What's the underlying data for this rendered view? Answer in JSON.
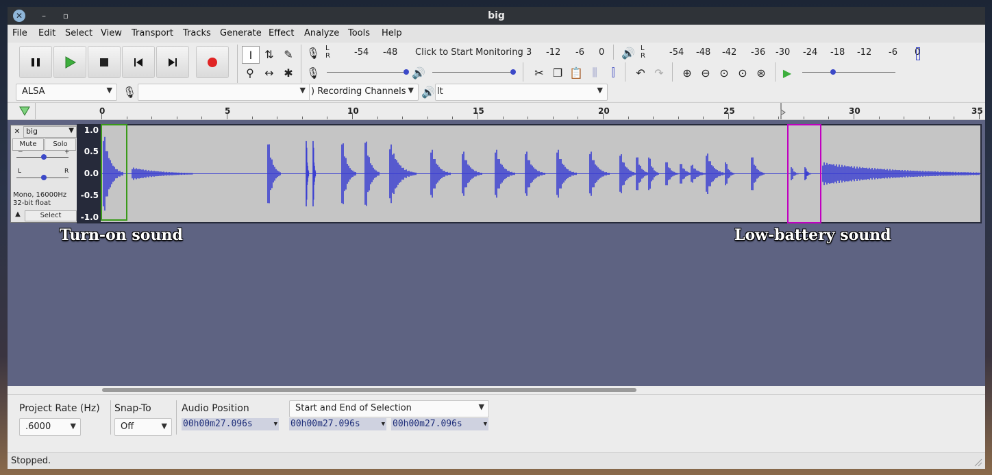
{
  "window": {
    "title": "big"
  },
  "menu": [
    "File",
    "Edit",
    "Select",
    "View",
    "Transport",
    "Tracks",
    "Generate",
    "Effect",
    "Analyze",
    "Tools",
    "Help"
  ],
  "meters": {
    "record_scale": [
      "-54",
      "-48",
      "Click to Start Monitoring",
      "3",
      "-12",
      "-6",
      "0"
    ],
    "play_scale": [
      "-54",
      "-48",
      "-42",
      "-36",
      "-30",
      "-24",
      "-18",
      "-12",
      "-6",
      "0"
    ],
    "record_lr": "L\nR",
    "play_lr": "L\nR"
  },
  "device": {
    "host": "ALSA",
    "recording_channels": ") Recording Channels",
    "playback_device": "lt"
  },
  "ruler": {
    "ticks": [
      "0",
      "5",
      "10",
      "15",
      "20",
      "25",
      "30",
      "35"
    ]
  },
  "track": {
    "name": "big",
    "mute": "Mute",
    "solo": "Solo",
    "info": "Mono, 16000Hz",
    "format": "32-bit float",
    "select": "Select",
    "y_labels": [
      "1.0",
      "0.5",
      "0.0",
      "-0.5",
      "-1.0"
    ]
  },
  "annotations": {
    "turn_on": "Turn-on sound",
    "low_battery": "Low-battery sound",
    "turn_on_color": "#3a9a1a",
    "low_battery_color": "#c000c0"
  },
  "selection_toolbar": {
    "project_rate_label": "Project Rate (Hz)",
    "project_rate_value": ".6000",
    "snap_to_label": "Snap-To",
    "snap_to_value": "Off",
    "audio_position_label": "Audio Position",
    "selection_mode": "Start and End of Selection",
    "audio_position_time": "00h00m27.096s",
    "selection_start": "00h00m27.096s",
    "selection_end": "00h00m27.096s"
  },
  "status": "Stopped.",
  "colors": {
    "waveform": "#3b3fd1",
    "wave_bg": "#c5c5c5",
    "track_area": "#5e6382",
    "record": "#e02424",
    "play": "#3cae3c"
  }
}
